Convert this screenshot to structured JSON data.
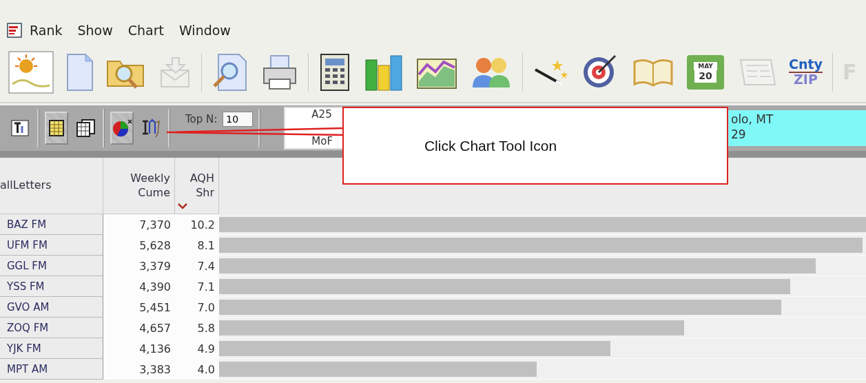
{
  "menu": {
    "items": [
      "Rank",
      "Show",
      "Chart",
      "Window"
    ]
  },
  "toolbar": {
    "buttons": [
      {
        "kind": "logo",
        "disabled": false
      },
      {
        "kind": "new",
        "disabled": false
      },
      {
        "kind": "open",
        "disabled": false
      },
      {
        "kind": "export",
        "disabled": true
      },
      {
        "kind": "sep"
      },
      {
        "kind": "preview",
        "disabled": false
      },
      {
        "kind": "print",
        "disabled": false
      },
      {
        "kind": "sep"
      },
      {
        "kind": "calculator",
        "disabled": false
      },
      {
        "kind": "bars",
        "disabled": false
      },
      {
        "kind": "area",
        "disabled": false
      },
      {
        "kind": "people",
        "disabled": false
      },
      {
        "kind": "sep"
      },
      {
        "kind": "wand",
        "disabled": false
      },
      {
        "kind": "target",
        "disabled": false
      },
      {
        "kind": "book",
        "disabled": false
      },
      {
        "kind": "calendar",
        "disabled": false,
        "month": "MAY",
        "day": "20"
      },
      {
        "kind": "newspaper",
        "disabled": true
      },
      {
        "kind": "county",
        "disabled": false,
        "top": "Cnty",
        "bottom": "ZIP"
      },
      {
        "kind": "sep"
      },
      {
        "kind": "letter",
        "disabled": true,
        "text": "F"
      }
    ]
  },
  "subbar": {
    "buttons": [
      {
        "kind": "tools",
        "pressed": false
      },
      {
        "kind": "sep"
      },
      {
        "kind": "grid",
        "pressed": true
      },
      {
        "kind": "copies",
        "pressed": false
      },
      {
        "kind": "sep"
      },
      {
        "kind": "pie",
        "pressed": true
      },
      {
        "kind": "charttool",
        "pressed": false
      }
    ],
    "top_n": {
      "label": "Top N:",
      "value": "10"
    },
    "demo": {
      "line_1": "A25",
      "line_2": "MoF"
    },
    "market": {
      "line_1": "olo, MT",
      "line_2": "29"
    }
  },
  "callout": {
    "text": "Click Chart Tool Icon"
  },
  "table": {
    "columns": [
      {
        "label": "allLetters",
        "sorted": false
      },
      {
        "label": "Weekly Cume",
        "sorted": false
      },
      {
        "label": "AQH Shr",
        "sorted": true
      }
    ],
    "rows": [
      {
        "call": "BAZ FM",
        "cume": "7,370",
        "shr": "10.2",
        "level": 1.0
      },
      {
        "call": "UFM FM",
        "cume": "5,628",
        "shr": "8.1",
        "level": 0.995
      },
      {
        "call": "GGL FM",
        "cume": "3,379",
        "shr": "7.4",
        "level": 0.922
      },
      {
        "call": "YSS FM",
        "cume": "4,390",
        "shr": "7.1",
        "level": 0.883
      },
      {
        "call": "GVO AM",
        "cume": "5,451",
        "shr": "7.0",
        "level": 0.869
      },
      {
        "call": "ZOQ FM",
        "cume": "4,657",
        "shr": "5.8",
        "level": 0.719
      },
      {
        "call": "YJK FM",
        "cume": "4,136",
        "shr": "4.9",
        "level": 0.605
      },
      {
        "call": "MPT AM",
        "cume": "3,383",
        "shr": "4.0",
        "level": 0.491
      }
    ]
  }
}
